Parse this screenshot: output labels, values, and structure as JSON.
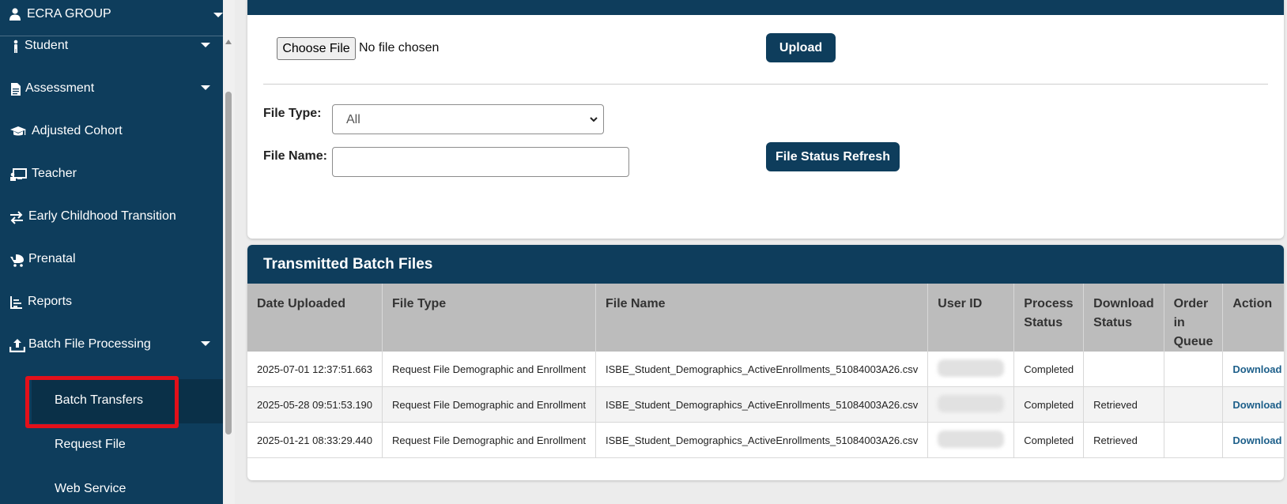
{
  "sidebar": {
    "org": "ECRA GROUP",
    "items": [
      {
        "label": "Student",
        "icon": "child-icon"
      },
      {
        "label": "Assessment",
        "icon": "document-icon"
      },
      {
        "label": "Adjusted Cohort",
        "icon": "graduation-cap-icon"
      },
      {
        "label": "Teacher",
        "icon": "teacher-board-icon"
      },
      {
        "label": "Early Childhood Transition",
        "icon": "exchange-arrows-icon"
      },
      {
        "label": "Prenatal",
        "icon": "baby-carriage-icon"
      },
      {
        "label": "Reports",
        "icon": "list-chart-icon"
      },
      {
        "label": "Batch File Processing",
        "icon": "upload-icon"
      }
    ],
    "sub_items": [
      {
        "label": "Batch Transfers"
      },
      {
        "label": "Request File"
      },
      {
        "label": "Web Service"
      }
    ]
  },
  "upload": {
    "choose_file": "Choose File",
    "no_file": "No file chosen",
    "upload_btn": "Upload",
    "file_type_label": "File Type:",
    "file_type_value": "All",
    "file_name_label": "File Name:",
    "refresh_btn": "File Status Refresh"
  },
  "files": {
    "title": "Transmitted Batch Files",
    "columns": [
      "Date Uploaded",
      "File Type",
      "File Name",
      "User ID",
      "Process Status",
      "Download Status",
      "Order in Queue",
      "Action"
    ],
    "rows": [
      {
        "date": "2025-07-01 12:37:51.663",
        "type": "Request File Demographic and Enrollment",
        "name": "ISBE_Student_Demographics_ActiveEnrollments_51084003A26.csv",
        "process": "Completed",
        "download": "",
        "order": "",
        "action": "Download"
      },
      {
        "date": "2025-05-28 09:51:53.190",
        "type": "Request File Demographic and Enrollment",
        "name": "ISBE_Student_Demographics_ActiveEnrollments_51084003A26.csv",
        "process": "Completed",
        "download": "Retrieved",
        "order": "",
        "action": "Download"
      },
      {
        "date": "2025-01-21 08:33:29.440",
        "type": "Request File Demographic and Enrollment",
        "name": "ISBE_Student_Demographics_ActiveEnrollments_51084003A26.csv",
        "process": "Completed",
        "download": "Retrieved",
        "order": "",
        "action": "Download"
      }
    ]
  },
  "colors": {
    "primary": "#0e3d5c",
    "highlight": "#e3101a",
    "link": "#1d5f8a"
  }
}
